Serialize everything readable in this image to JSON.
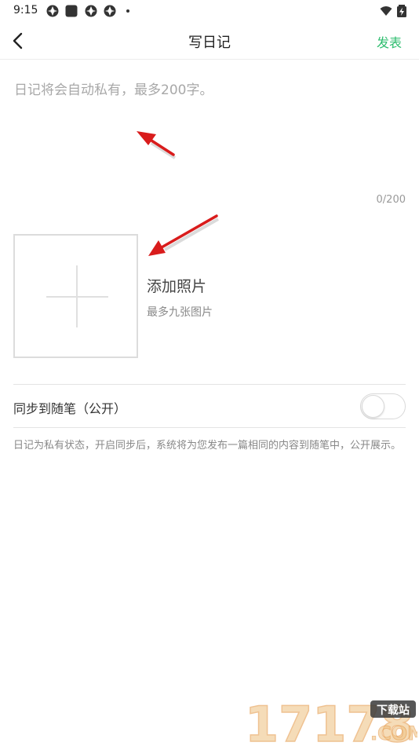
{
  "status_bar": {
    "time": "9:15"
  },
  "header": {
    "title": "写日记",
    "publish_label": "发表"
  },
  "editor": {
    "placeholder": "日记将会自动私有，最多200字。",
    "value": "",
    "counter": "0/200"
  },
  "photos": {
    "title": "添加照片",
    "hint": "最多九张图片"
  },
  "sync": {
    "label": "同步到随笔（公开）",
    "enabled": false,
    "note": "日记为私有状态，开启同步后，系统将为您发布一篇相同的内容到随笔中，公开展示。"
  },
  "watermark": {
    "number": "17178",
    "tag": "下载站",
    "suffix": ".COM"
  },
  "colors": {
    "accent": "#2dbd6e",
    "annotation_arrow": "#d91c1c"
  }
}
